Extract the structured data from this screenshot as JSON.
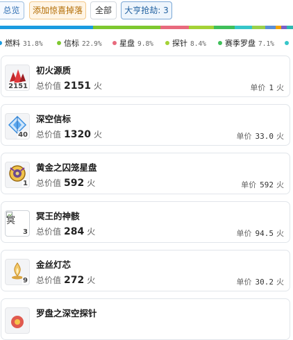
{
  "tabs": [
    {
      "label": "总览"
    },
    {
      "label": "添加惊喜掉落"
    },
    {
      "label": "全部"
    },
    {
      "label": "大亨抢劫: 3"
    }
  ],
  "distribution": {
    "segments": [
      {
        "color": "#1a9be0",
        "share": 31.8
      },
      {
        "color": "#7ec82f",
        "share": 22.9
      },
      {
        "color": "#e86a7d",
        "share": 9.8
      },
      {
        "color": "#a4d236",
        "share": 8.4
      },
      {
        "color": "#3fbf5a",
        "share": 7.1
      },
      {
        "color": "#36c6c9",
        "share": 6.0
      },
      {
        "color": "#9ad04a",
        "share": 4.5
      },
      {
        "color": "#5a8fd8",
        "share": 3.5
      },
      {
        "color": "#f4a300",
        "share": 2.0
      },
      {
        "color": "#7b5fc9",
        "share": 2.0
      },
      {
        "color": "#2fb8b0",
        "share": 2.0
      }
    ],
    "legend": [
      {
        "label": "燃料",
        "pct": "31.8%",
        "color": "#1a9be0"
      },
      {
        "label": "信标",
        "pct": "22.9%",
        "color": "#7ec82f"
      },
      {
        "label": "星盘",
        "pct": "9.8%",
        "color": "#e86a7d"
      },
      {
        "label": "探针",
        "pct": "8.4%",
        "color": "#a4d236"
      },
      {
        "label": "赛季罗盘",
        "pct": "7.1%",
        "color": "#3fbf5a"
      },
      {
        "label": "",
        "pct": "",
        "color": "#36c6c9"
      }
    ]
  },
  "labels": {
    "total": "总价值",
    "unit_price": "单价",
    "currency": "火"
  },
  "items": [
    {
      "name": "初火源质",
      "qty": "2151",
      "total": "2151",
      "unit": "1",
      "icon": "crystal-icon"
    },
    {
      "name": "深空信标",
      "qty": "40",
      "total": "1320",
      "unit": "33.0",
      "icon": "beacon-icon"
    },
    {
      "name": "黄金之囚笼星盘",
      "qty": "1",
      "total": "592",
      "unit": "592",
      "icon": "astrolabe-icon"
    },
    {
      "name": "冥王的神骸",
      "qty": "3",
      "total": "284",
      "unit": "94.5",
      "icon": "broken-image-icon",
      "broken_alt": "冥"
    },
    {
      "name": "金丝灯芯",
      "qty": "9",
      "total": "272",
      "unit": "30.2",
      "icon": "wick-icon"
    },
    {
      "name": "罗盘之深空探针",
      "qty": "",
      "total": "",
      "unit": "",
      "icon": "probe-icon"
    }
  ]
}
